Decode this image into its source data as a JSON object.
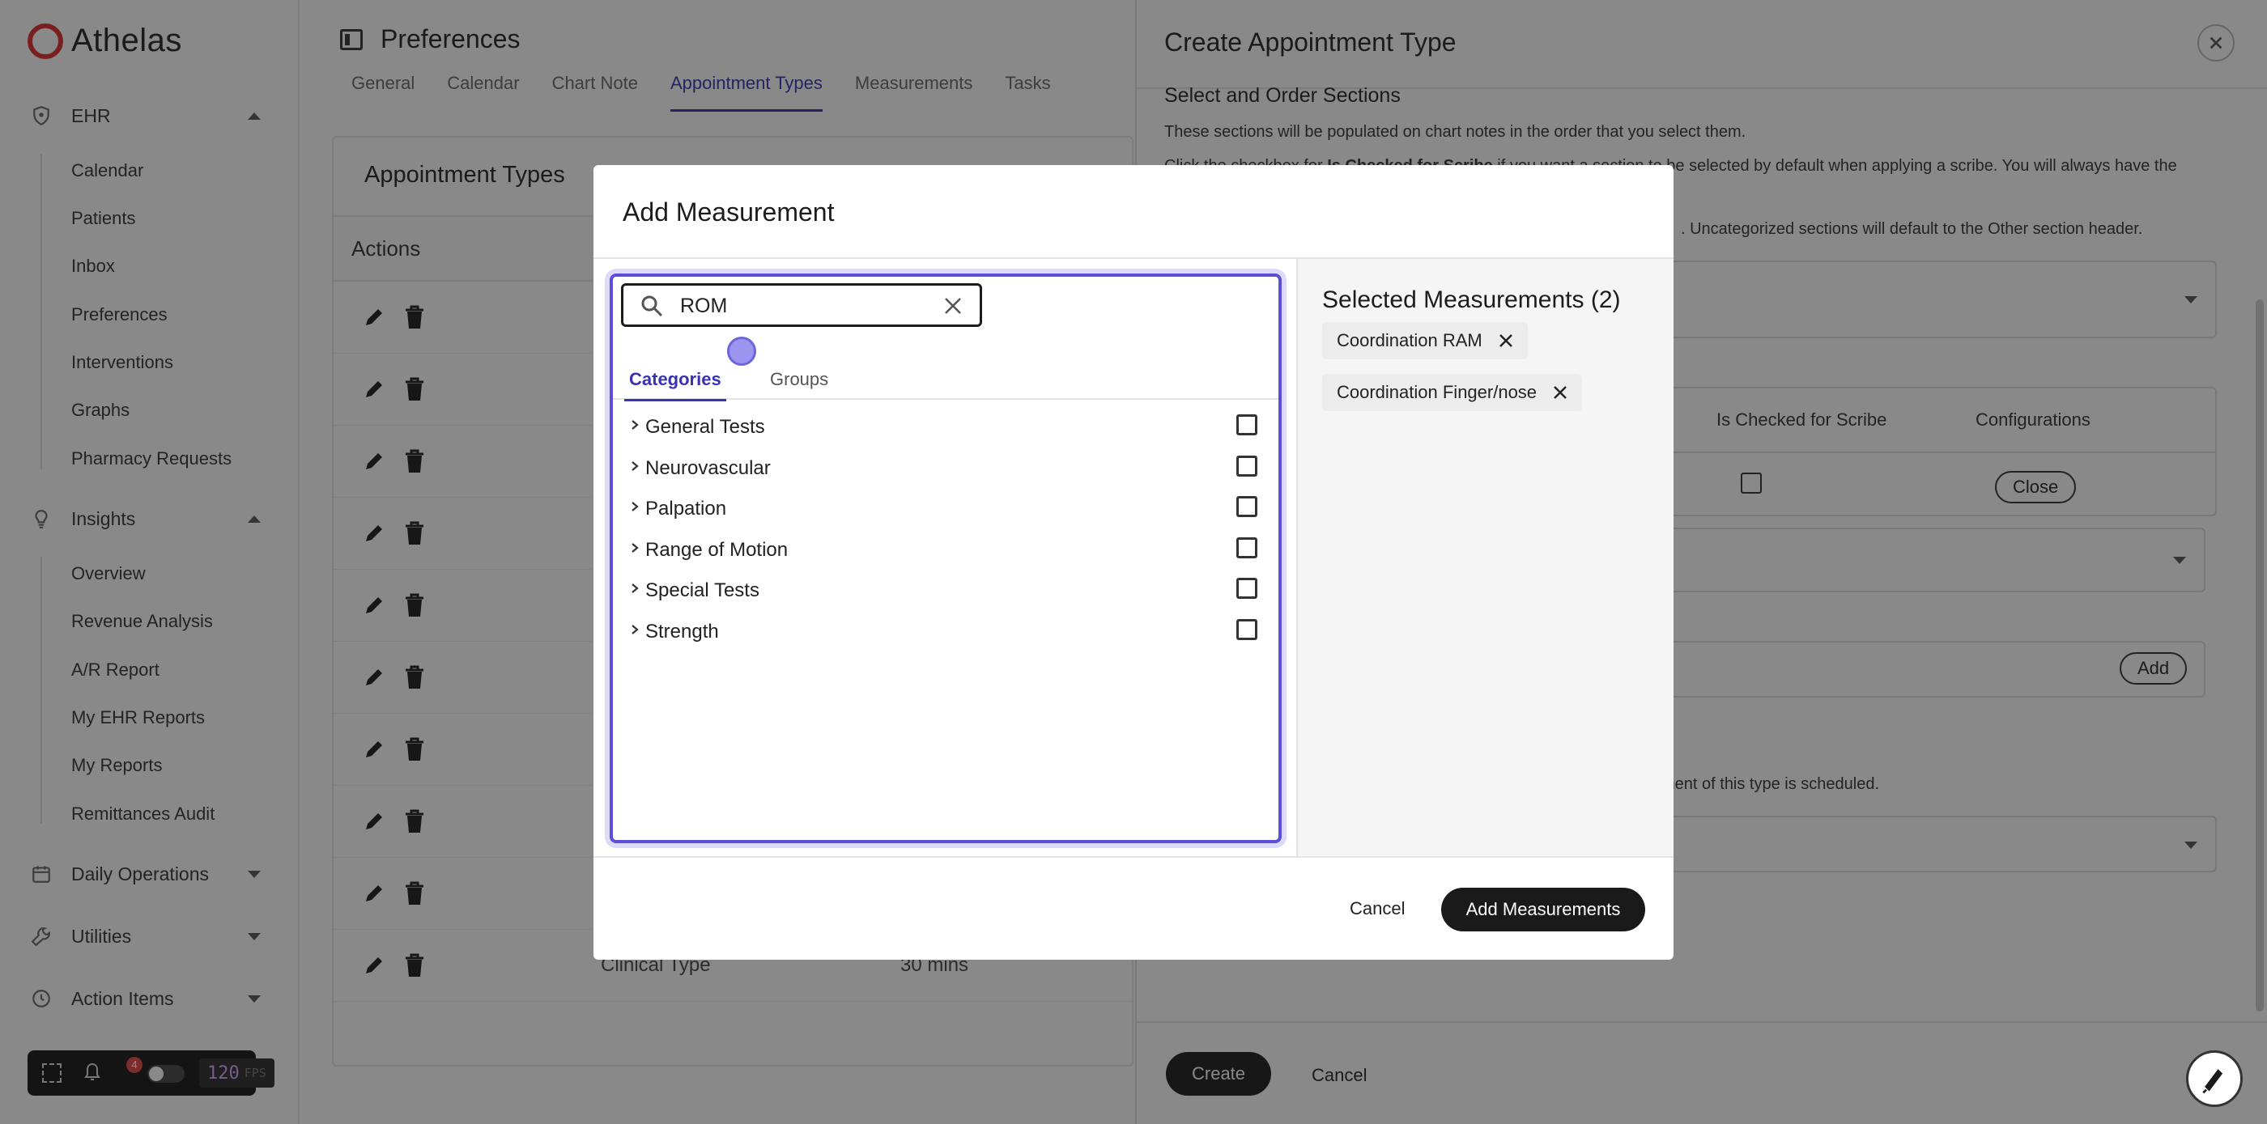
{
  "brand": {
    "name": "Athelas",
    "accent": "#e02b2b"
  },
  "sidebar": {
    "sections": [
      {
        "label": "EHR",
        "icon": "shield-icon",
        "expanded": true,
        "items": [
          "Calendar",
          "Patients",
          "Inbox",
          "Preferences",
          "Interventions",
          "Graphs",
          "Pharmacy Requests"
        ]
      },
      {
        "label": "Insights",
        "icon": "lightbulb-icon",
        "expanded": true,
        "items": [
          "Overview",
          "Revenue Analysis",
          "A/R Report",
          "My EHR Reports",
          "My Reports",
          "Remittances Audit"
        ]
      },
      {
        "label": "Daily Operations",
        "icon": "calendar-icon",
        "expanded": false,
        "items": []
      },
      {
        "label": "Utilities",
        "icon": "wrench-icon",
        "expanded": false,
        "items": []
      },
      {
        "label": "Action Items",
        "icon": "clock-icon",
        "expanded": false,
        "items": []
      }
    ]
  },
  "devbar": {
    "notifications": "4",
    "fps_value": "120",
    "fps_label": "FPS"
  },
  "main": {
    "title": "Preferences",
    "tabs": [
      "General",
      "Calendar",
      "Chart Note",
      "Appointment Types",
      "Measurements",
      "Tasks"
    ],
    "active_tab": "Appointment Types",
    "card_title": "Appointment Types",
    "actions_header": "Actions",
    "last_row": {
      "type": "Clinical Type",
      "duration": "30 mins"
    }
  },
  "drawer": {
    "title": "Create Appointment Type",
    "section_heading": "Select and Order Sections",
    "p1": "These sections will be populated on chart notes in the order that you select them.",
    "p2_prefix": "Click the checkbox for ",
    "p2_bold": "Is Checked for Scribe",
    "p2_suffix": " if you want a section to be selected by default when applying a scribe. You will always have the",
    "p3": ". Uncategorized sections will default to the Other section header.",
    "col_scribe": "Is Checked for Scribe",
    "col_config": "Configurations",
    "close_pill": "Close",
    "add_pill": "Add",
    "p4": "ment of this type is scheduled.",
    "create_label": "Create",
    "cancel_label": "Cancel"
  },
  "modal": {
    "title": "Add Measurement",
    "search_value": "ROM",
    "tabs": [
      "Categories",
      "Groups"
    ],
    "active_tab": "Categories",
    "categories": [
      "General Tests",
      "Neurovascular",
      "Palpation",
      "Range of Motion",
      "Special Tests",
      "Strength"
    ],
    "selected_title": "Selected Measurements (2)",
    "selected": [
      "Coordination RAM",
      "Coordination Finger/nose"
    ],
    "cancel_label": "Cancel",
    "submit_label": "Add Measurements"
  }
}
